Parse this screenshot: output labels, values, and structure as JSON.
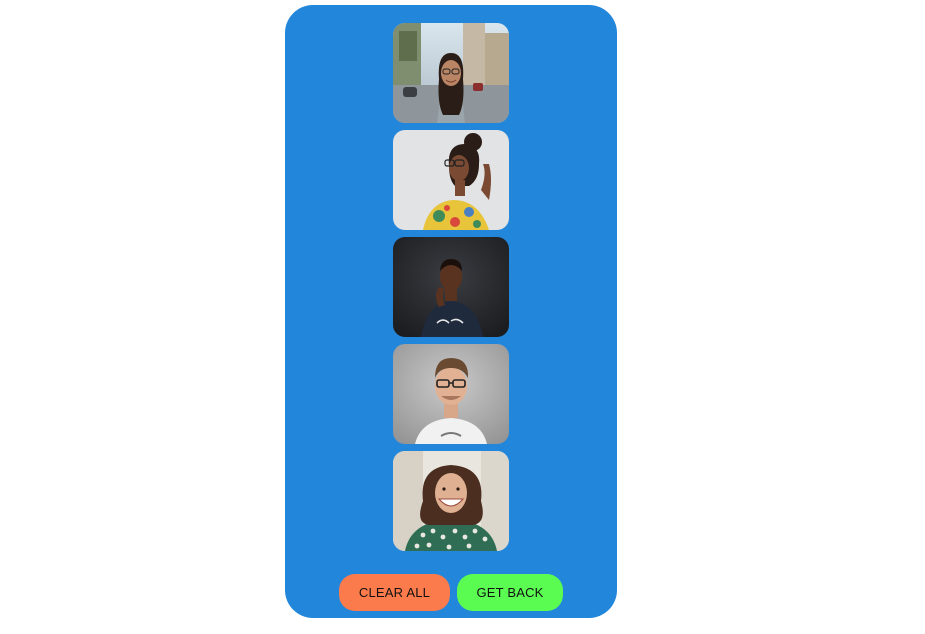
{
  "colors": {
    "panel": "#2286da",
    "clear_button": "#fb7b4c",
    "get_back_button": "#5bfc52",
    "page_background": "#ffffff"
  },
  "photos": [
    {
      "name": "woman-street-glasses"
    },
    {
      "name": "woman-floral-shirt-glasses"
    },
    {
      "name": "man-dark-tshirt"
    },
    {
      "name": "man-glasses-white-tshirt"
    },
    {
      "name": "woman-curly-hair-smiling"
    }
  ],
  "actions": {
    "clear_label": "CLEAR ALL",
    "back_label": "GET BACK"
  }
}
